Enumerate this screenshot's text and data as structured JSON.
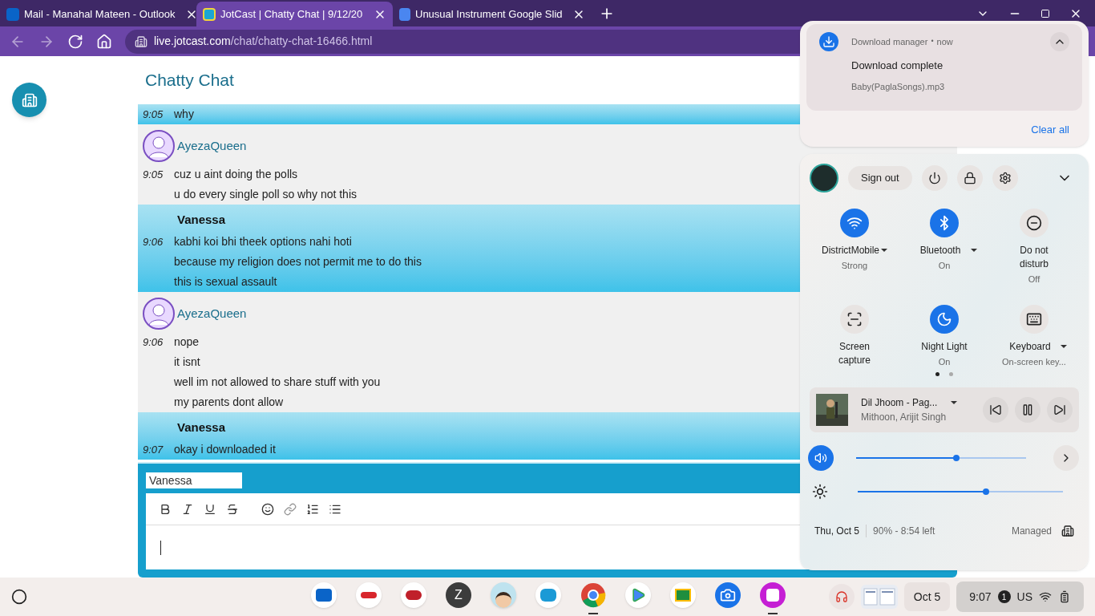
{
  "browser": {
    "tabs": [
      {
        "title": "Mail - Manahal Mateen - Outlook",
        "kind": "outlook",
        "selected": false
      },
      {
        "title": "JotCast | Chatty Chat | 9/12/20",
        "kind": "jotcast",
        "selected": true
      },
      {
        "title": "Unusual Instrument Google Slid",
        "kind": "docs",
        "selected": false
      }
    ],
    "url": {
      "host": "live.jotcast.com",
      "path": "/chat/chatty-chat-16466.html"
    }
  },
  "page": {
    "title": "Chatty Chat",
    "messages": [
      {
        "highlighted": true,
        "lines": [
          {
            "time": "9:05",
            "text": "why"
          }
        ]
      },
      {
        "highlighted": false,
        "avatar": true,
        "user": "AyezaQueen",
        "lines": [
          {
            "time": "9:05",
            "text": "cuz u aint doing the polls"
          },
          {
            "text": "u do every single poll so why not this"
          }
        ]
      },
      {
        "highlighted": true,
        "avatar": false,
        "user": "Vanessa",
        "lines": [
          {
            "time": "9:06",
            "text": "kabhi koi bhi theek options nahi hoti"
          },
          {
            "text": "because my religion does not permit me to do this"
          },
          {
            "text": "this is sexual assault"
          }
        ]
      },
      {
        "highlighted": false,
        "avatar": true,
        "user": "AyezaQueen",
        "lines": [
          {
            "time": "9:06",
            "text": "nope"
          },
          {
            "text": "it isnt"
          },
          {
            "text": "well im not allowed to share stuff with you"
          },
          {
            "text": "my parents dont allow"
          }
        ]
      },
      {
        "highlighted": true,
        "avatar": false,
        "user": "Vanessa",
        "lines": [
          {
            "time": "9:07",
            "text": "okay i downloaded it"
          }
        ]
      }
    ],
    "composer": {
      "name": "Vanessa"
    }
  },
  "notification": {
    "app": "Download manager",
    "separator": "•",
    "time": "now",
    "title": "Download complete",
    "file": "Baby(PaglaSongs).mp3",
    "clear_all": "Clear all"
  },
  "quick_settings": {
    "sign_out": "Sign out",
    "tiles": [
      {
        "kind": "wifi",
        "label": "DistrictMobile",
        "sub": "Strong",
        "on": true,
        "menu": true
      },
      {
        "kind": "bluetooth",
        "label": "Bluetooth",
        "sub": "On",
        "on": true,
        "menu": true
      },
      {
        "kind": "dnd",
        "label": "Do not disturb",
        "sub": "Off",
        "on": false,
        "menu": false
      },
      {
        "kind": "capture",
        "label": "Screen capture",
        "on": false,
        "menu": false
      },
      {
        "kind": "night",
        "label": "Night Light",
        "sub": "On",
        "on": true,
        "menu": false
      },
      {
        "kind": "keyboard",
        "label": "Keyboard",
        "sub": "On-screen key...",
        "on": false,
        "menu": true
      }
    ],
    "pages": [
      {
        "selected": true
      },
      {
        "selected": false
      }
    ],
    "media": {
      "title": "Dil Jhoom - Pag...",
      "artist": "Mithoon, Arijit Singh"
    },
    "volume": {
      "level": 0.59
    },
    "brightness": {
      "level": 0.625
    },
    "footer": {
      "date": "Thu, Oct 5",
      "battery": "90% - 8:54 left",
      "managed": "Managed"
    }
  },
  "shelf": {
    "apps": [
      {
        "kind": "outlook",
        "running": false
      },
      {
        "kind": "wetip",
        "running": false
      },
      {
        "kind": "stop",
        "running": false
      },
      {
        "kind": "letter",
        "label": "Z",
        "running": false
      },
      {
        "kind": "avatar",
        "running": false
      },
      {
        "kind": "classlink",
        "running": false
      },
      {
        "kind": "chrome",
        "running": true
      },
      {
        "kind": "play",
        "running": false
      },
      {
        "kind": "classroom",
        "running": false
      },
      {
        "kind": "camera",
        "running": false
      },
      {
        "kind": "canvas",
        "running": true
      }
    ],
    "date": "Oct 5",
    "time": "9:07",
    "notifications": "1",
    "ime": "US"
  }
}
